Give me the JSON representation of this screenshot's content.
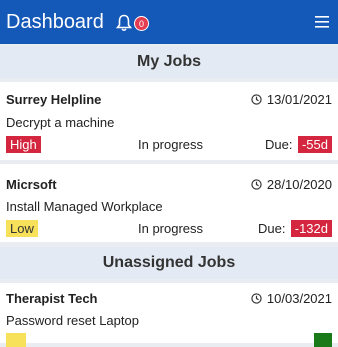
{
  "header": {
    "title": "Dashboard",
    "notification_count": "0",
    "bell_icon": "bell-icon",
    "menu_icon": "hamburger-menu-icon"
  },
  "colors": {
    "header_bg": "#1458b8",
    "high": "#d4263e",
    "low": "#f7e05a",
    "overdue": "#d4263e"
  },
  "my_jobs": {
    "title": "My Jobs",
    "jobs": [
      {
        "client": "Surrey Helpline",
        "date": "13/01/2021",
        "task": "Decrypt a machine",
        "priority": "High",
        "status": "In progress",
        "due_label": "Due:",
        "due": "-55d"
      },
      {
        "client": "Micrsoft",
        "date": "28/10/2020",
        "task": "Install Managed Workplace",
        "priority": "Low",
        "status": "In progress",
        "due_label": "Due:",
        "due": "-132d"
      }
    ]
  },
  "unassigned_jobs": {
    "title": "Unassigned Jobs",
    "jobs": [
      {
        "client": "Therapist Tech",
        "date": "10/03/2021",
        "task": "Password reset Laptop"
      }
    ]
  }
}
